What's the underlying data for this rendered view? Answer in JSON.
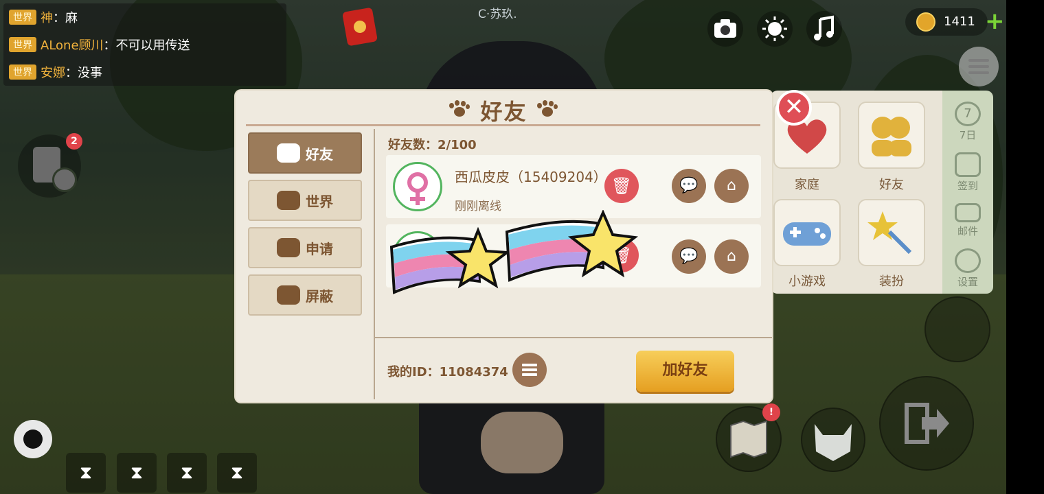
{
  "chat": [
    {
      "tag": "世界",
      "name": "神",
      "sep": "：",
      "message": "麻"
    },
    {
      "tag": "世界",
      "name": "ALone顾川",
      "sep": "：",
      "message": "不可以用传送"
    },
    {
      "tag": "世界",
      "name": "安娜",
      "sep": "：",
      "message": "没事"
    }
  ],
  "room_name": "C·苏玖.",
  "top_bar": {
    "coins": "1411",
    "plus": "+"
  },
  "task_badge": "2",
  "dialog": {
    "title": "好友",
    "close": "✕",
    "tabs": [
      {
        "label": "好友",
        "active": true
      },
      {
        "label": "世界",
        "active": false
      },
      {
        "label": "申请",
        "active": false
      },
      {
        "label": "屏蔽",
        "active": false
      }
    ],
    "friend_count": "好友数：2/100",
    "friends": [
      {
        "name": "西瓜皮皮（15409204）",
        "status": "刚刚离线"
      }
    ],
    "my_id": "我的ID：11084374",
    "add_friend": "加好友"
  },
  "side_panel": {
    "tiles": [
      "家庭",
      "好友",
      "小游戏",
      "装扮"
    ],
    "strip": [
      "7日",
      "签到",
      "邮件",
      "设置"
    ],
    "strip_top_number": "7"
  },
  "icons": {
    "camera": "camera-icon",
    "brightness": "sun-icon",
    "music": "music-note-icon",
    "menu": "menu-list-icon",
    "task": "task-clock-icon",
    "map": "map-icon",
    "cat": "cat-face-icon",
    "exit": "exit-door-icon"
  }
}
